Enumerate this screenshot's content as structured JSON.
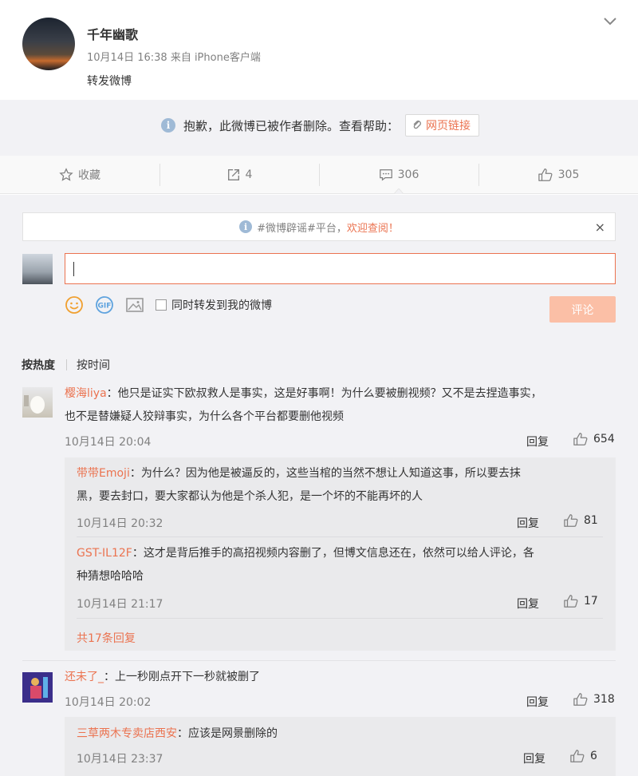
{
  "post": {
    "username": "千年幽歌",
    "meta": "10月14日 16:38 来自 iPhone客户端",
    "text": "转发微博"
  },
  "deleted": {
    "message": "抱歉，此微博已被作者删除。查看帮助：",
    "link_label": "网页链接"
  },
  "actions": {
    "favorite": "收藏",
    "repost": "4",
    "comment": "306",
    "like": "305"
  },
  "notice": {
    "text": "#微博辟谣#平台，",
    "highlight": "欢迎查阅！",
    "close": "×"
  },
  "composer": {
    "checkbox_label": "同时转发到我的微博",
    "submit": "评论"
  },
  "sort": {
    "hot": "按热度",
    "time": "按时间"
  },
  "comments": [
    {
      "name": "樱海liya",
      "text1": "：他只是证实下欧叔救人是事实，这是好事啊！为什么要被删视频？又不是去捏造事实，",
      "text2": "也不是替嫌疑人狡辩事实，为什么各个平台都要删他视频",
      "time": "10月14日 20:04",
      "reply": "回复",
      "likes": "654",
      "replies": [
        {
          "name": "带带Emoji",
          "text1": "：为什么？因为他是被逼反的，这些当棺的当然不想让人知道这事，所以要去抹",
          "text2": "黑，要去封口，要大家都认为他是个杀人犯，是一个坏的不能再坏的人",
          "time": "10月14日 20:32",
          "reply": "回复",
          "likes": "81"
        },
        {
          "name": "GST-IL12F",
          "text1": "：这才是背后推手的高招视频内容删了，但博文信息还在，依然可以给人评论，各",
          "text2": "种猜想哈哈哈",
          "time": "10月14日 21:17",
          "reply": "回复",
          "likes": "17"
        }
      ],
      "more": "共17条回复"
    },
    {
      "name": "还未了_",
      "text1": "：上一秒刚点开下一秒就被删了",
      "time": "10月14日 20:02",
      "reply": "回复",
      "likes": "318",
      "replies": [
        {
          "name": "三草两木专卖店西安",
          "text1": "：应该是网景删除的",
          "time": "10月14日 23:37",
          "reply": "回复",
          "likes": "6"
        }
      ]
    }
  ]
}
